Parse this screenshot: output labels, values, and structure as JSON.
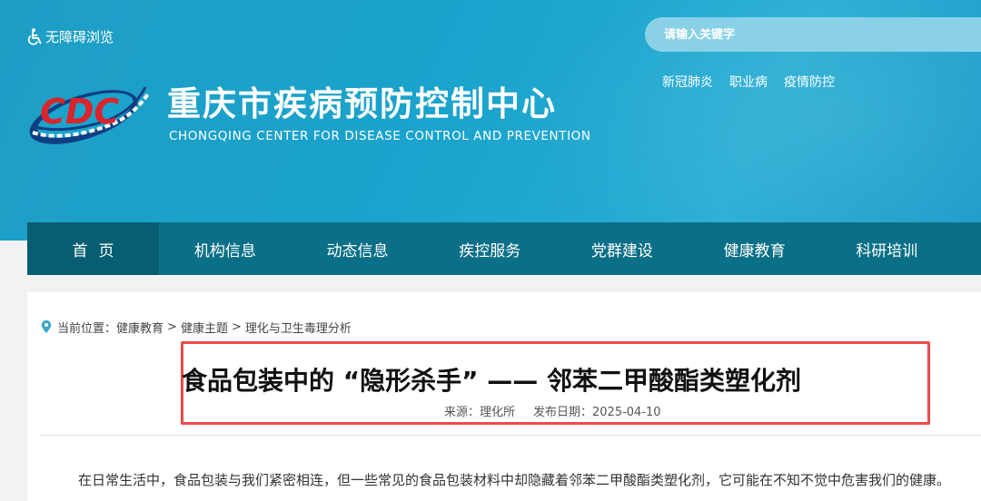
{
  "header": {
    "accessibility_label": "无障碍浏览",
    "search_placeholder": "请输入关键字",
    "hot_links": [
      "新冠肺炎",
      "职业病",
      "疫情防控"
    ],
    "title_cn": "重庆市疾病预防控制中心",
    "title_en": "CHONGQING CENTER FOR DISEASE CONTROL AND PREVENTION",
    "logo_text": "CDC"
  },
  "nav": {
    "items": [
      "首页",
      "机构信息",
      "动态信息",
      "疾控服务",
      "党群建设",
      "健康教育",
      "科研培训"
    ]
  },
  "breadcrumb": {
    "prefix": "当前位置：",
    "items": [
      "健康教育",
      "健康主题",
      "理化与卫生毒理分析"
    ],
    "separator": ">"
  },
  "article": {
    "title": "食品包装中的 “隐形杀手” —— 邻苯二甲酸酯类塑化剂",
    "source_label": "来源：理化所",
    "date_label": "发布日期：2025-04-10",
    "first_paragraph": "在日常生活中，食品包装与我们紧密相连，但一些常见的食品包装材料中却隐藏着邻苯二甲酸酯类塑化剂，它可能在不知不觉中危害我们的健康。"
  },
  "colors": {
    "header_bg": "#1aa3cc",
    "nav_bg": "#0b6f87",
    "nav_active_bg": "#075d71",
    "highlight_border": "#ec4a4a"
  }
}
